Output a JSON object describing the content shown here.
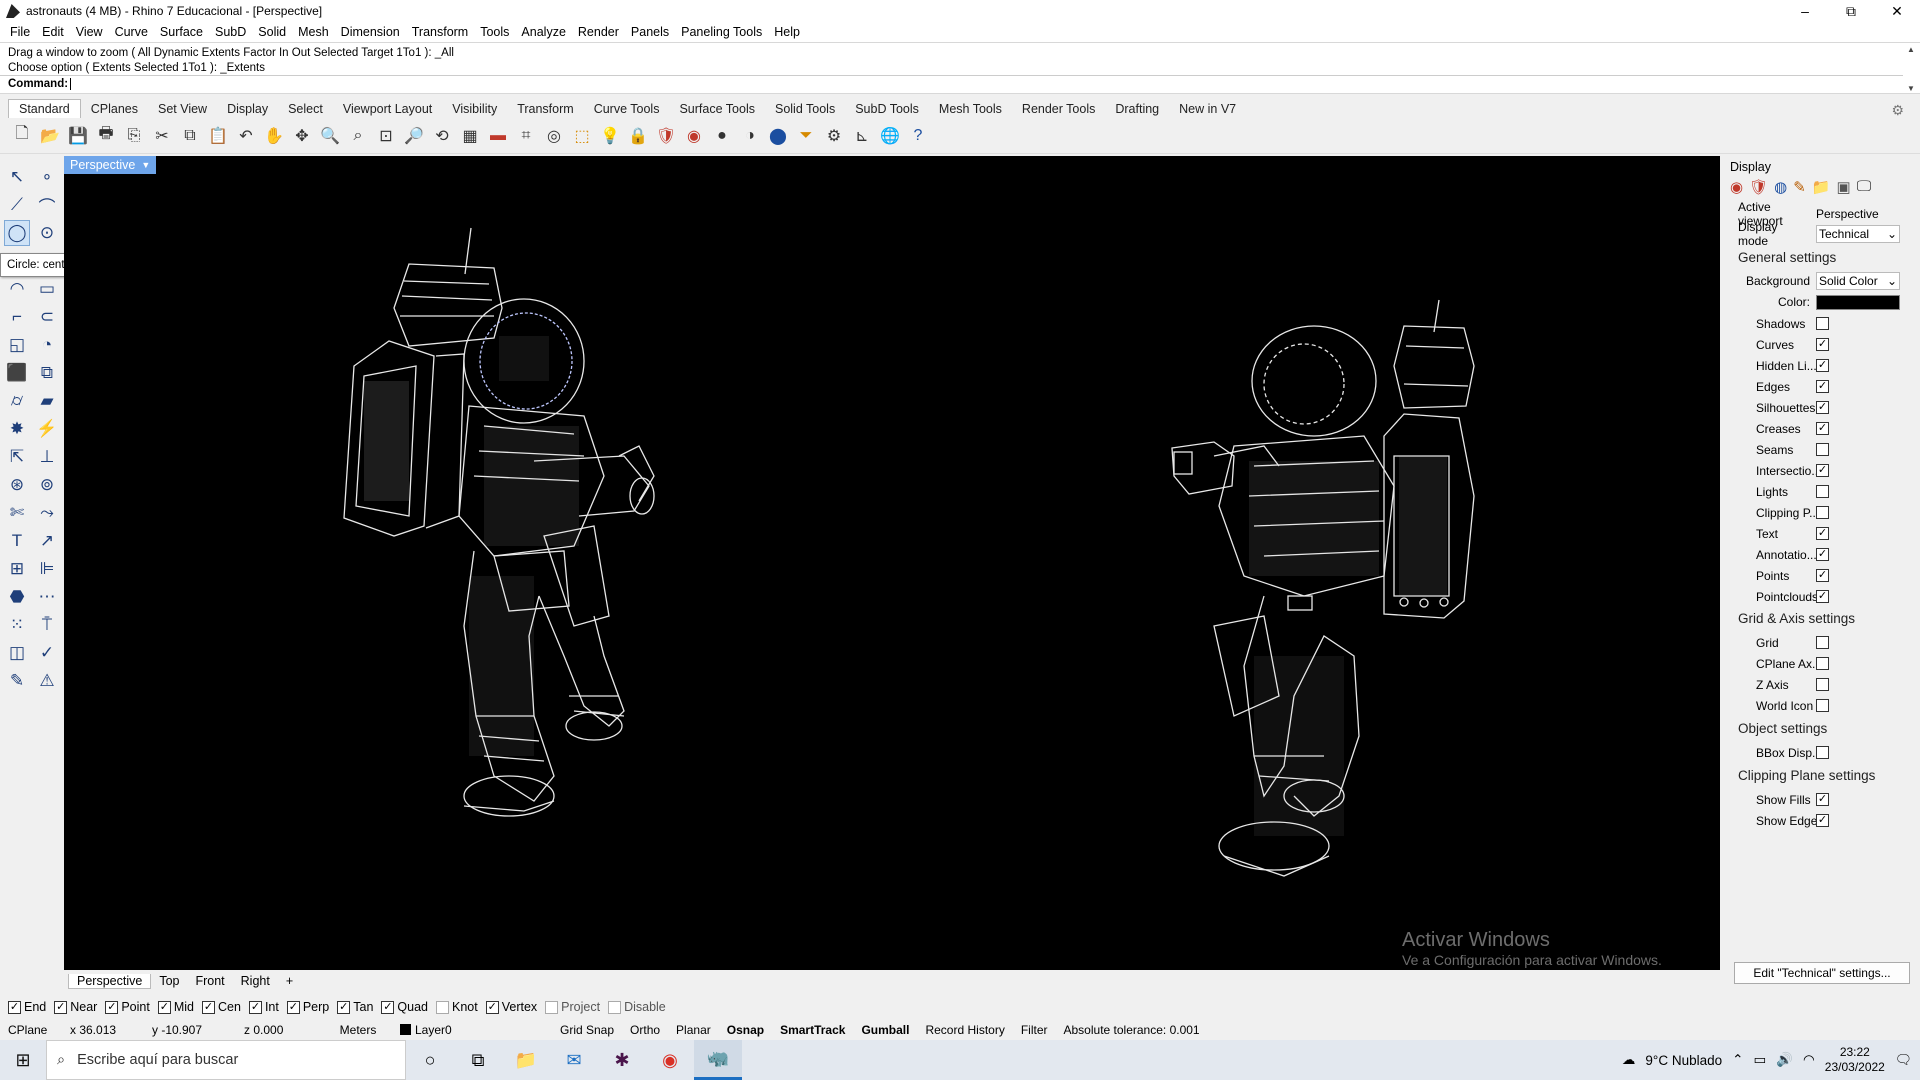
{
  "window": {
    "title": "astronauts (4 MB) - Rhino 7 Educacional - [Perspective]",
    "minimize": "–",
    "maximize": "⧉",
    "close": "✕"
  },
  "menu": [
    "File",
    "Edit",
    "View",
    "Curve",
    "Surface",
    "SubD",
    "Solid",
    "Mesh",
    "Dimension",
    "Transform",
    "Tools",
    "Analyze",
    "Render",
    "Panels",
    "Paneling Tools",
    "Help"
  ],
  "command": {
    "history_1": "Drag a window to zoom ( All  Dynamic  Extents  Factor  In  Out  Selected  Target  1To1 ): _All",
    "history_2": "Choose option ( Extents  Selected  1To1 ): _Extents",
    "prompt_label": "Command:",
    "prompt_value": ""
  },
  "toolbar_tabs": [
    "Standard",
    "CPlanes",
    "Set View",
    "Display",
    "Select",
    "Viewport Layout",
    "Visibility",
    "Transform",
    "Curve Tools",
    "Surface Tools",
    "Solid Tools",
    "SubD Tools",
    "Mesh Tools",
    "Render Tools",
    "Drafting",
    "New in V7"
  ],
  "standard_icons": [
    {
      "name": "new-file-icon",
      "glyph": "🗋",
      "color": ""
    },
    {
      "name": "open-icon",
      "glyph": "📂",
      "color": "c3"
    },
    {
      "name": "save-icon",
      "glyph": "💾",
      "color": ""
    },
    {
      "name": "print-icon",
      "glyph": "🖶",
      "color": ""
    },
    {
      "name": "import-icon",
      "glyph": "⎘",
      "color": ""
    },
    {
      "name": "cut-icon",
      "glyph": "✂",
      "color": ""
    },
    {
      "name": "copy-icon",
      "glyph": "⧉",
      "color": ""
    },
    {
      "name": "paste-icon",
      "glyph": "📋",
      "color": "c3"
    },
    {
      "name": "undo-icon",
      "glyph": "↶",
      "color": ""
    },
    {
      "name": "pan-icon",
      "glyph": "✋",
      "color": ""
    },
    {
      "name": "rotate-view-icon",
      "glyph": "✥",
      "color": ""
    },
    {
      "name": "zoom-dynamic-icon",
      "glyph": "🔍",
      "color": ""
    },
    {
      "name": "zoom-window-icon",
      "glyph": "⌕",
      "color": ""
    },
    {
      "name": "zoom-extents-icon",
      "glyph": "⊡",
      "color": ""
    },
    {
      "name": "zoom-selected-icon",
      "glyph": "🔎",
      "color": ""
    },
    {
      "name": "undo-view-icon",
      "glyph": "⟲",
      "color": ""
    },
    {
      "name": "viewport-grid-icon",
      "glyph": "▦",
      "color": ""
    },
    {
      "name": "cplane-icon",
      "glyph": "▬",
      "color": "c2"
    },
    {
      "name": "snap-icon",
      "glyph": "⌗",
      "color": ""
    },
    {
      "name": "point-icon",
      "glyph": "◎",
      "color": ""
    },
    {
      "name": "select-icon",
      "glyph": "⬚",
      "color": "c3"
    },
    {
      "name": "light-icon",
      "glyph": "💡",
      "color": ""
    },
    {
      "name": "lock-icon",
      "glyph": "🔒",
      "color": ""
    },
    {
      "name": "layer-icon",
      "glyph": "🛡",
      "color": "c2"
    },
    {
      "name": "color-wheel-icon",
      "glyph": "◉",
      "color": "c2"
    },
    {
      "name": "shaded-sphere-icon",
      "glyph": "●",
      "color": ""
    },
    {
      "name": "material-sphere-icon",
      "glyph": "◑",
      "color": ""
    },
    {
      "name": "render-sphere-icon",
      "glyph": "⬤",
      "color": "c1"
    },
    {
      "name": "filter-icon",
      "glyph": "⏷",
      "color": "c3"
    },
    {
      "name": "options-icon",
      "glyph": "⚙",
      "color": ""
    },
    {
      "name": "dimension-icon",
      "glyph": "⊾",
      "color": ""
    },
    {
      "name": "globe-icon",
      "glyph": "🌐",
      "color": "c4"
    },
    {
      "name": "help-icon",
      "glyph": "?",
      "color": "c1"
    }
  ],
  "sidebar_icons": [
    {
      "name": "select-arrow-icon",
      "glyph": "↖"
    },
    {
      "name": "point-tool-icon",
      "glyph": "∘"
    },
    {
      "name": "polyline-icon",
      "glyph": "⟋"
    },
    {
      "name": "curve-icon",
      "glyph": "⌒"
    },
    {
      "name": "circle-icon",
      "glyph": "◯",
      "selected": true
    },
    {
      "name": "ellipse-icon",
      "glyph": "⊙"
    },
    {
      "name": "arc-icon",
      "glyph": "◠"
    },
    {
      "name": "rectangle-icon",
      "glyph": "▭"
    },
    {
      "name": "fillet-icon",
      "glyph": "⌐"
    },
    {
      "name": "offset-icon",
      "glyph": "⊂"
    },
    {
      "name": "surface-icon",
      "glyph": "◱"
    },
    {
      "name": "revolve-icon",
      "glyph": "◔"
    },
    {
      "name": "box-icon",
      "glyph": "⬛"
    },
    {
      "name": "boolean-icon",
      "glyph": "⧉"
    },
    {
      "name": "cylinder-icon",
      "glyph": "⌭"
    },
    {
      "name": "extrude-icon",
      "glyph": "▰"
    },
    {
      "name": "mesh-icon",
      "glyph": "✸"
    },
    {
      "name": "render-tool-icon",
      "glyph": "⚡"
    },
    {
      "name": "move-icon",
      "glyph": "⇱"
    },
    {
      "name": "transform-icon",
      "glyph": "⊥"
    },
    {
      "name": "group-icon",
      "glyph": "⊛"
    },
    {
      "name": "ungroup-icon",
      "glyph": "⊚"
    },
    {
      "name": "trim-icon",
      "glyph": "✄"
    },
    {
      "name": "split-icon",
      "glyph": "⤳"
    },
    {
      "name": "text-icon",
      "glyph": "T"
    },
    {
      "name": "dimension-tool-icon",
      "glyph": "↗"
    },
    {
      "name": "block-icon",
      "glyph": "⊞"
    },
    {
      "name": "align-icon",
      "glyph": "⊫"
    },
    {
      "name": "solid-tools-icon",
      "glyph": "⬣"
    },
    {
      "name": "analysis-icon",
      "glyph": "⋯"
    },
    {
      "name": "array-icon",
      "glyph": "⁙"
    },
    {
      "name": "history-icon",
      "glyph": "⍑"
    },
    {
      "name": "edit-points-icon",
      "glyph": "◫"
    },
    {
      "name": "check-icon",
      "glyph": "✓"
    },
    {
      "name": "drafting-icon",
      "glyph": "✎"
    },
    {
      "name": "warning-icon",
      "glyph": "⚠"
    }
  ],
  "tooltip": "Circle: center, radius",
  "viewport": {
    "label": "Perspective",
    "watermark_1": "Activar Windows",
    "watermark_2": "Ve a Configuración para activar Windows."
  },
  "viewport_tabs": [
    "Perspective",
    "Top",
    "Front",
    "Right",
    "+"
  ],
  "osnaps": [
    {
      "label": "End",
      "on": true
    },
    {
      "label": "Near",
      "on": true
    },
    {
      "label": "Point",
      "on": true
    },
    {
      "label": "Mid",
      "on": true
    },
    {
      "label": "Cen",
      "on": true
    },
    {
      "label": "Int",
      "on": true
    },
    {
      "label": "Perp",
      "on": true
    },
    {
      "label": "Tan",
      "on": true
    },
    {
      "label": "Quad",
      "on": true
    },
    {
      "label": "Knot",
      "on": false
    },
    {
      "label": "Vertex",
      "on": true
    },
    {
      "label": "Project",
      "on": false
    },
    {
      "label": "Disable",
      "on": false
    }
  ],
  "status": {
    "cplane": "CPlane",
    "x": "x 36.013",
    "y": "y -10.907",
    "z": "z 0.000",
    "units": "Meters",
    "layer": "Layer0",
    "grid_snap": "Grid Snap",
    "ortho": "Ortho",
    "planar": "Planar",
    "osnap": "Osnap",
    "smarttrack": "SmartTrack",
    "gumball": "Gumball",
    "record_history": "Record History",
    "filter": "Filter",
    "tolerance": "Absolute tolerance: 0.001"
  },
  "taskbar": {
    "search_placeholder": "Escribe aquí para buscar",
    "weather": "9°C  Nublado",
    "time": "23:22",
    "date": "23/03/2022"
  },
  "panel": {
    "title": "Display",
    "active_viewport_label": "Active viewport",
    "active_viewport_value": "Perspective",
    "display_mode_label": "Display mode",
    "display_mode_value": "Technical",
    "general_heading": "General settings",
    "background_label": "Background",
    "background_value": "Solid Color",
    "color_label": "Color:",
    "color_value": "#000000",
    "general_items": [
      {
        "label": "Shadows",
        "on": false
      },
      {
        "label": "Curves",
        "on": true
      },
      {
        "label": "Hidden Li...",
        "on": true
      },
      {
        "label": "Edges",
        "on": true
      },
      {
        "label": "Silhouettes",
        "on": true
      },
      {
        "label": "Creases",
        "on": true
      },
      {
        "label": "Seams",
        "on": false
      },
      {
        "label": "Intersectio...",
        "on": true
      },
      {
        "label": "Lights",
        "on": false
      },
      {
        "label": "Clipping P...",
        "on": false
      },
      {
        "label": "Text",
        "on": true
      },
      {
        "label": "Annotatio...",
        "on": true
      },
      {
        "label": "Points",
        "on": true
      },
      {
        "label": "Pointclouds",
        "on": true
      }
    ],
    "grid_heading": "Grid & Axis settings",
    "grid_items": [
      {
        "label": "Grid",
        "on": false
      },
      {
        "label": "CPlane Ax...",
        "on": false
      },
      {
        "label": "Z Axis",
        "on": false
      },
      {
        "label": "World Icon",
        "on": false
      }
    ],
    "object_heading": "Object settings",
    "object_items": [
      {
        "label": "BBox Disp...",
        "on": false
      }
    ],
    "clipping_heading": "Clipping Plane settings",
    "clipping_items": [
      {
        "label": "Show Fills",
        "on": true
      },
      {
        "label": "Show Edges",
        "on": true
      }
    ],
    "edit_button": "Edit \"Technical\" settings..."
  }
}
